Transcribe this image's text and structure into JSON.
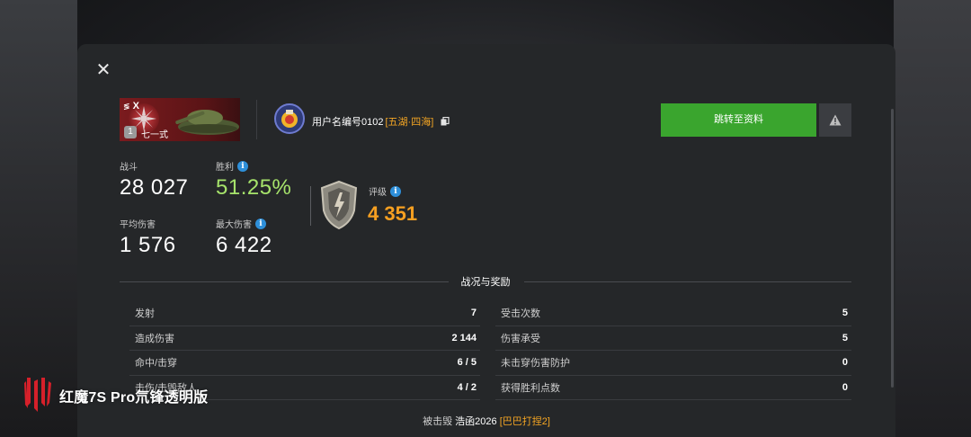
{
  "dialog": {
    "close_label": "✕",
    "tank": {
      "tier_roman": "X",
      "level": "1",
      "name": "七一式"
    },
    "player": {
      "username": "用户名编号0102",
      "clan_tag": "[五湖·四海]"
    },
    "buttons": {
      "profile_label": "跳转至资料"
    },
    "stats": {
      "battles_label": "战斗",
      "battles_value": "28 027",
      "winrate_label": "胜利",
      "winrate_value": "51.25%",
      "avg_damage_label": "平均伤害",
      "avg_damage_value": "1 576",
      "max_damage_label": "最大伤害",
      "max_damage_value": "6 422",
      "rating_label": "评级",
      "rating_value": "4 351"
    },
    "section_title": "战况与奖励",
    "table_left": [
      {
        "label": "发射",
        "value": "7"
      },
      {
        "label": "造成伤害",
        "value": "2 144"
      },
      {
        "label": "命中/击穿",
        "value": "6 / 5"
      },
      {
        "label": "击伤/击毁敌人",
        "value": "4 / 2"
      }
    ],
    "table_right": [
      {
        "label": "受击次数",
        "value": "5"
      },
      {
        "label": "伤害承受",
        "value": "5"
      },
      {
        "label": "未击穿伤害防护",
        "value": "0"
      },
      {
        "label": "获得胜利点数",
        "value": "0"
      }
    ],
    "killed_by": {
      "prefix": "被击毁",
      "name": "浩函2026",
      "clan": "[巴巴打捏2]"
    }
  },
  "watermark": {
    "text": "红魔7S Pro氘锋透明版"
  },
  "colors": {
    "accent_green": "#3aa52e",
    "winrate_green": "#a6e36b",
    "rating_orange": "#f7a021",
    "clan_orange": "#f5a623",
    "info_blue": "#2e8fd9"
  }
}
